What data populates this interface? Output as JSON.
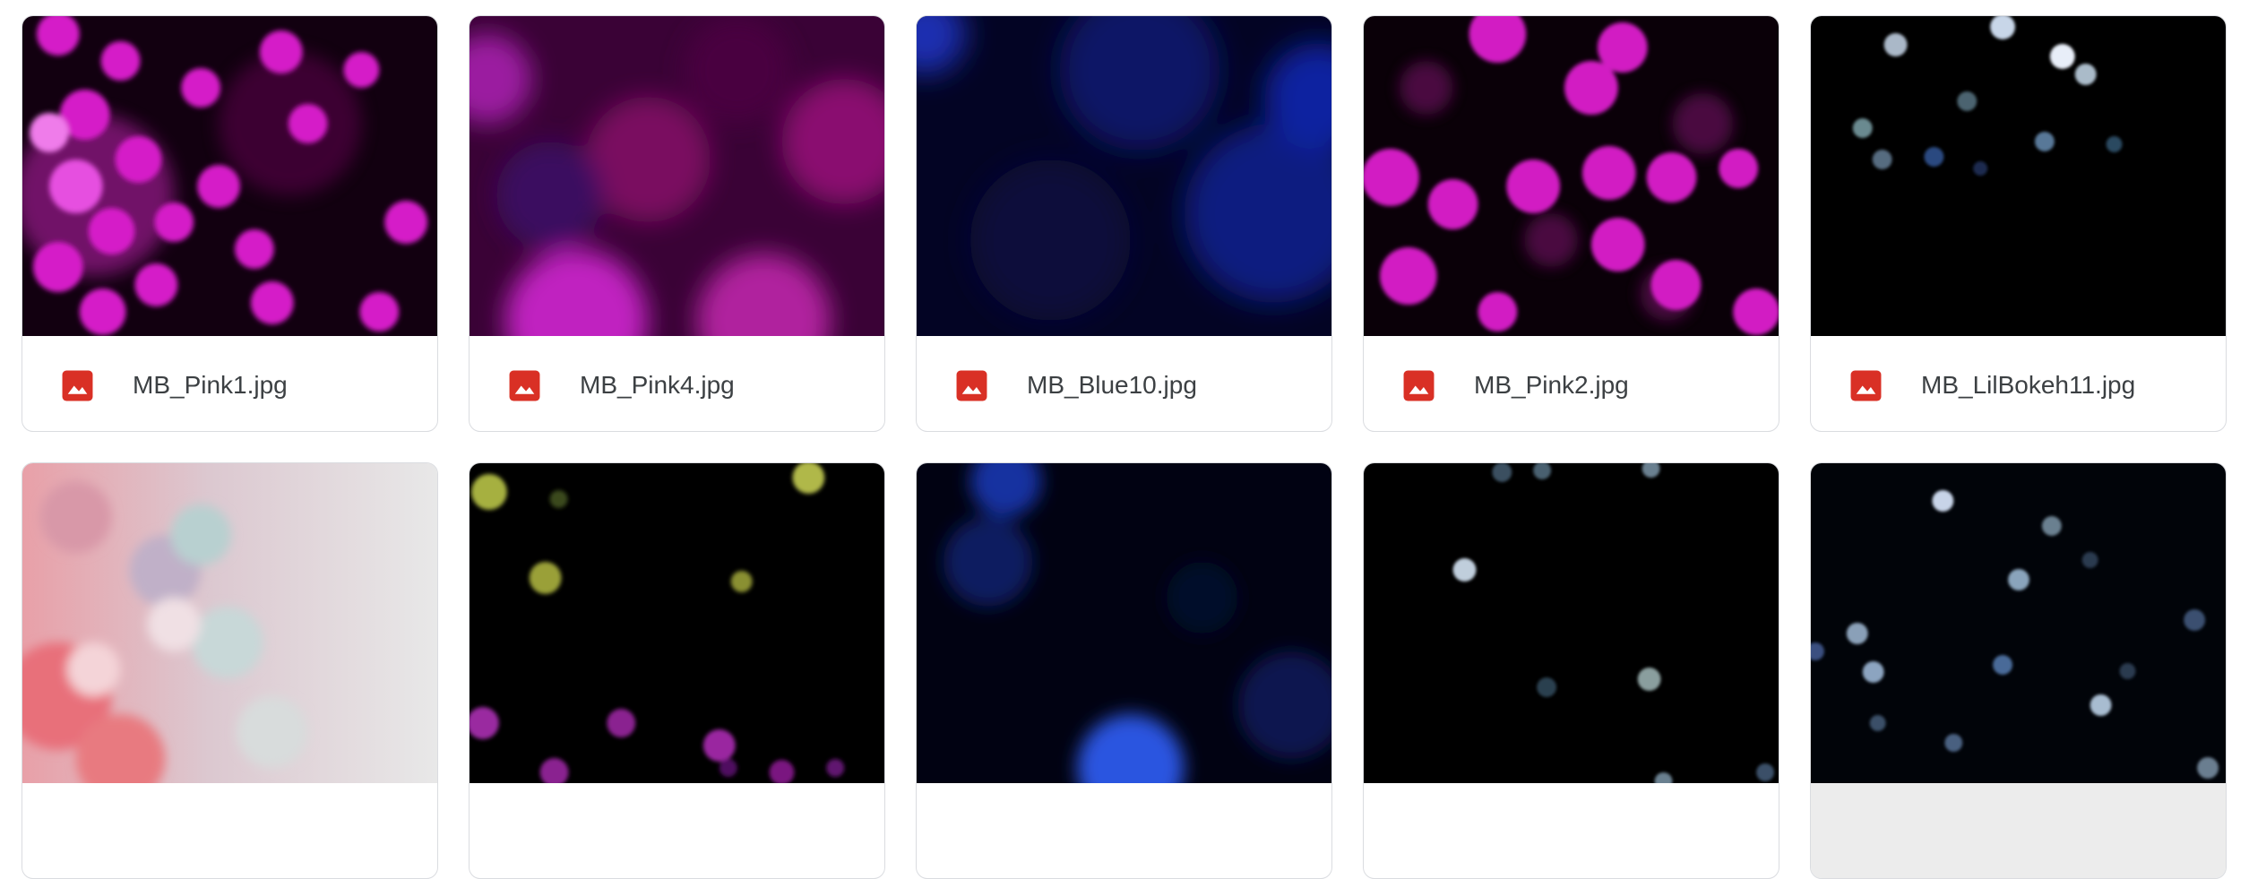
{
  "files": [
    {
      "name": "MB_Pink1.jpg",
      "icon": "image-file-icon"
    },
    {
      "name": "MB_Pink4.jpg",
      "icon": "image-file-icon"
    },
    {
      "name": "MB_Blue10.jpg",
      "icon": "image-file-icon"
    },
    {
      "name": "MB_Pink2.jpg",
      "icon": "image-file-icon"
    },
    {
      "name": "MB_LilBokeh11.jpg",
      "icon": "image-file-icon"
    }
  ],
  "colors": {
    "icon_red": "#d93025",
    "card_border": "#dadce0",
    "text": "#3c4043"
  }
}
